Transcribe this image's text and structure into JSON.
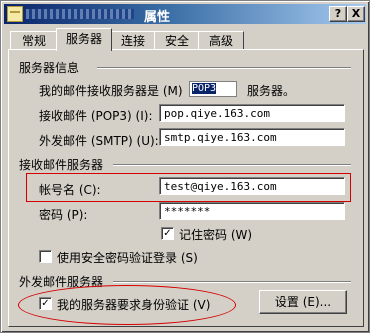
{
  "window": {
    "title": "属性",
    "buttons": {
      "help": "?",
      "close": "X"
    }
  },
  "tabs": [
    {
      "label": "常规",
      "active": false
    },
    {
      "label": "服务器",
      "active": true
    },
    {
      "label": "连接",
      "active": false
    },
    {
      "label": "安全",
      "active": false
    },
    {
      "label": "高级",
      "active": false
    }
  ],
  "server_info": {
    "section_title": "服务器信息",
    "incoming_type_prefix": "我的邮件接收服务器是 (M)",
    "incoming_type_value": "POP3",
    "incoming_type_suffix": "服务器。",
    "pop3_label": "接收邮件 (POP3) (I):",
    "pop3_value": "pop.qiye.163.com",
    "smtp_label": "外发邮件 (SMTP) (U):",
    "smtp_value": "smtp.qiye.163.com"
  },
  "incoming_server": {
    "section_title": "接收邮件服务器",
    "account_label": "帐号名 (C):",
    "account_value": "test@qiye.163.com",
    "password_label": "密码 (P):",
    "password_value": "*******",
    "remember_password_label": "记住密码 (W)",
    "remember_password_checked": true,
    "spa_label": "使用安全密码验证登录 (S)",
    "spa_checked": false
  },
  "outgoing_server": {
    "section_title": "外发邮件服务器",
    "auth_label": "我的服务器要求身份验证 (V)",
    "auth_checked": true,
    "settings_button": "设置 (E)..."
  }
}
